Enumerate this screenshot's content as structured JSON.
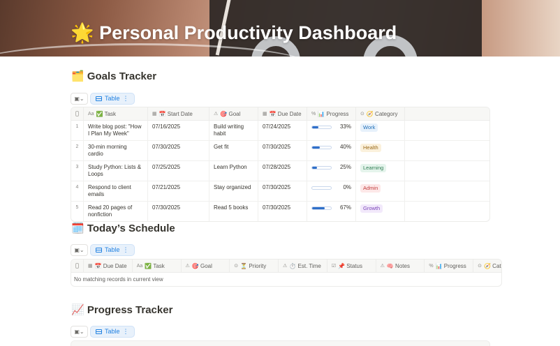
{
  "page": {
    "title": "🌟 Personal Productivity Dashboard"
  },
  "goals": {
    "title": "🗂️ Goals Tracker",
    "view_label": "Table",
    "columns": [
      {
        "label": "✅ Task",
        "icon": "Aa"
      },
      {
        "label": "📅 Start Date",
        "icon": "▦"
      },
      {
        "label": "🎯 Goal",
        "icon": "⚠"
      },
      {
        "label": "📅 Due Date",
        "icon": "▦"
      },
      {
        "label": "📊 Progress",
        "icon": "%"
      },
      {
        "label": "🧭 Category",
        "icon": "⊙"
      }
    ],
    "rows": [
      {
        "num": "1",
        "task": "Write blog post: \"How I Plan My Week\"",
        "start": "07/16/2025",
        "goal": "Build writing habit",
        "due": "07/24/2025",
        "progress": 33,
        "progress_label": "33%",
        "category": "Work",
        "category_class": "work"
      },
      {
        "num": "2",
        "task": "30-min morning cardio",
        "start": "07/30/2025",
        "goal": "Get fit",
        "due": "07/30/2025",
        "progress": 40,
        "progress_label": "40%",
        "category": "Health",
        "category_class": "health"
      },
      {
        "num": "3",
        "task": "Study Python: Lists & Loops",
        "start": "07/25/2025",
        "goal": "Learn Python",
        "due": "07/28/2025",
        "progress": 25,
        "progress_label": "25%",
        "category": "Learning",
        "category_class": "learning"
      },
      {
        "num": "4",
        "task": "Respond to client emails",
        "start": "07/21/2025",
        "goal": "Stay organized",
        "due": "07/30/2025",
        "progress": 0,
        "progress_label": "0%",
        "category": "Admin",
        "category_class": "admin"
      },
      {
        "num": "5",
        "task": "Read 20 pages of nonfiction",
        "start": "07/30/2025",
        "goal": "Read 5 books",
        "due": "07/30/2025",
        "progress": 67,
        "progress_label": "67%",
        "category": "Growth",
        "category_class": "growth"
      }
    ]
  },
  "schedule": {
    "title": "🗓️ Today’s Schedule",
    "view_label": "Table",
    "columns": [
      {
        "label": "📅 Due Date",
        "icon": "▦"
      },
      {
        "label": "✅ Task",
        "icon": "Aa"
      },
      {
        "label": "🎯 Goal",
        "icon": "⚠"
      },
      {
        "label": "⏳ Priority",
        "icon": "⊙"
      },
      {
        "label": "⏱️ Est. Time",
        "icon": "⚠"
      },
      {
        "label": "📌 Status",
        "icon": "☑"
      },
      {
        "label": "🧠 Notes",
        "icon": "⚠"
      },
      {
        "label": "📊 Progress",
        "icon": "%"
      },
      {
        "label": "🧭 Cate",
        "icon": "⊙"
      }
    ],
    "empty_text": "No matching records in current view"
  },
  "progress": {
    "title": "📈 Progress Tracker",
    "view_label": "Table"
  },
  "colors": {
    "accent": "#2383e2",
    "progress_fill": "#2f6fc9"
  }
}
